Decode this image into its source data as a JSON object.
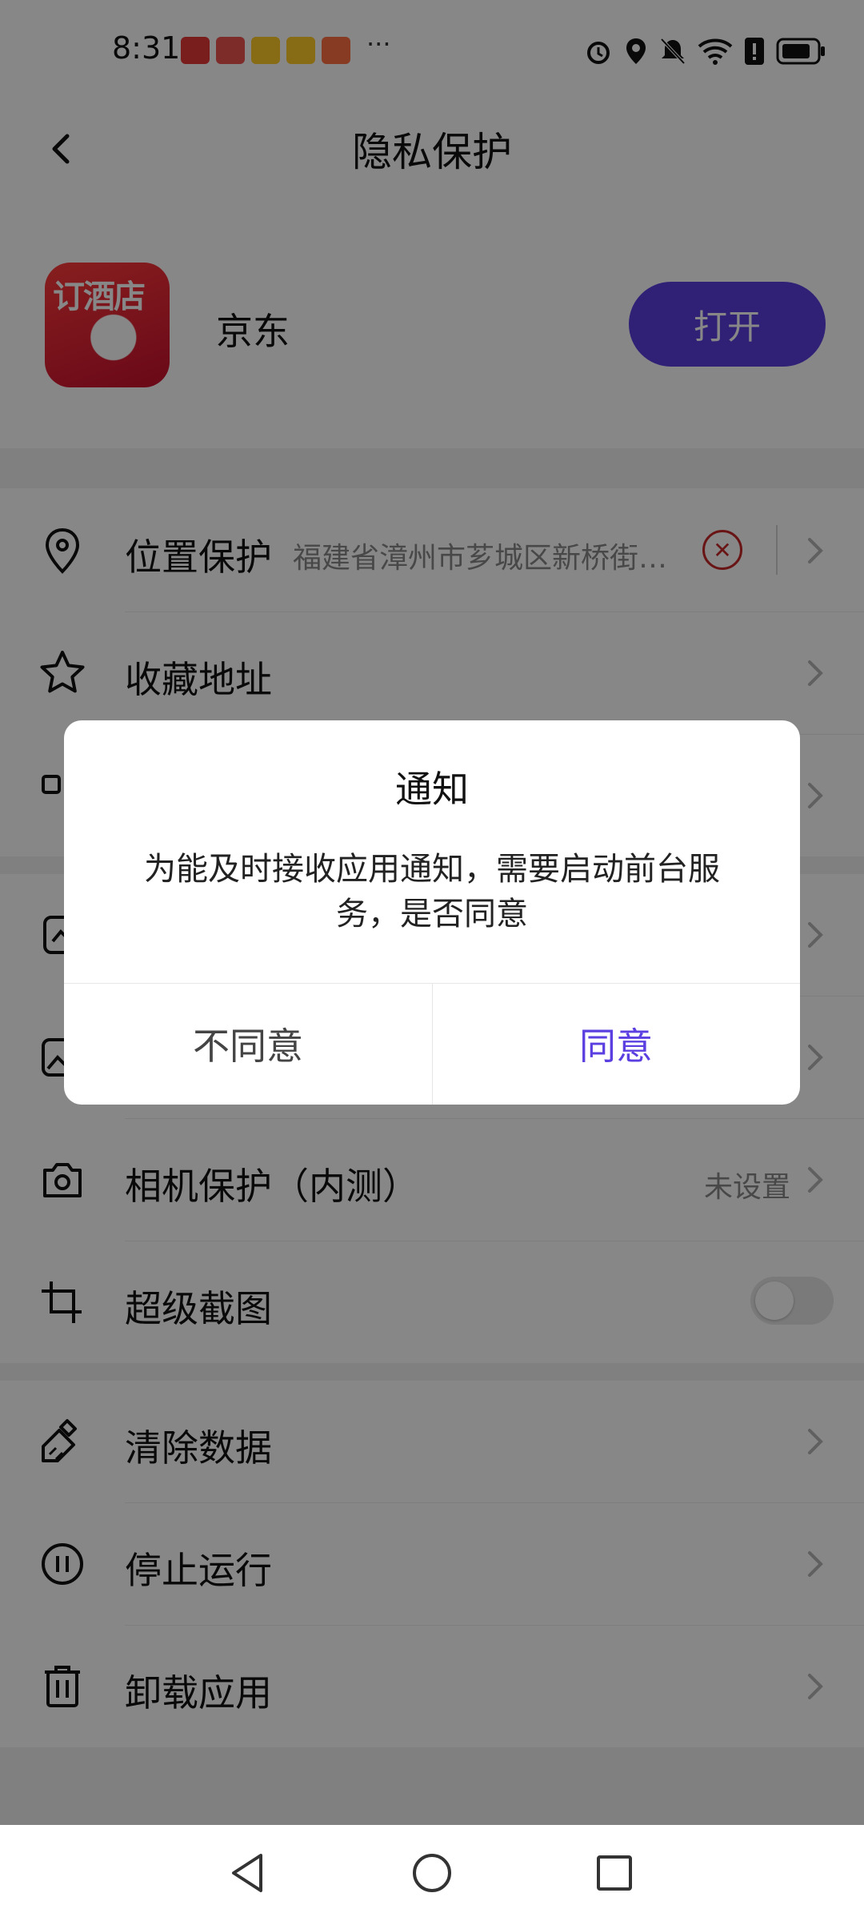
{
  "status_bar": {
    "time": "8:31",
    "more": "···"
  },
  "header": {
    "title": "隐私保护"
  },
  "app": {
    "name": "京东",
    "icon_text": "订酒店",
    "open_label": "打开"
  },
  "rows": {
    "location": {
      "label": "位置保护",
      "value": "福建省漳州市芗城区新桥街道…"
    },
    "favorites": {
      "label": "收藏地址"
    },
    "camera": {
      "label": "相机保护（内测）",
      "value": "未设置"
    },
    "screenshot": {
      "label": "超级截图"
    },
    "clear": {
      "label": "清除数据"
    },
    "stop": {
      "label": "停止运行"
    },
    "uninstall": {
      "label": "卸载应用"
    }
  },
  "dialog": {
    "title": "通知",
    "message": "为能及时接收应用通知，需要启动前台服务，是否同意",
    "disagree": "不同意",
    "agree": "同意"
  },
  "colors": {
    "accent": "#5b3fe0",
    "danger": "#c62828"
  }
}
